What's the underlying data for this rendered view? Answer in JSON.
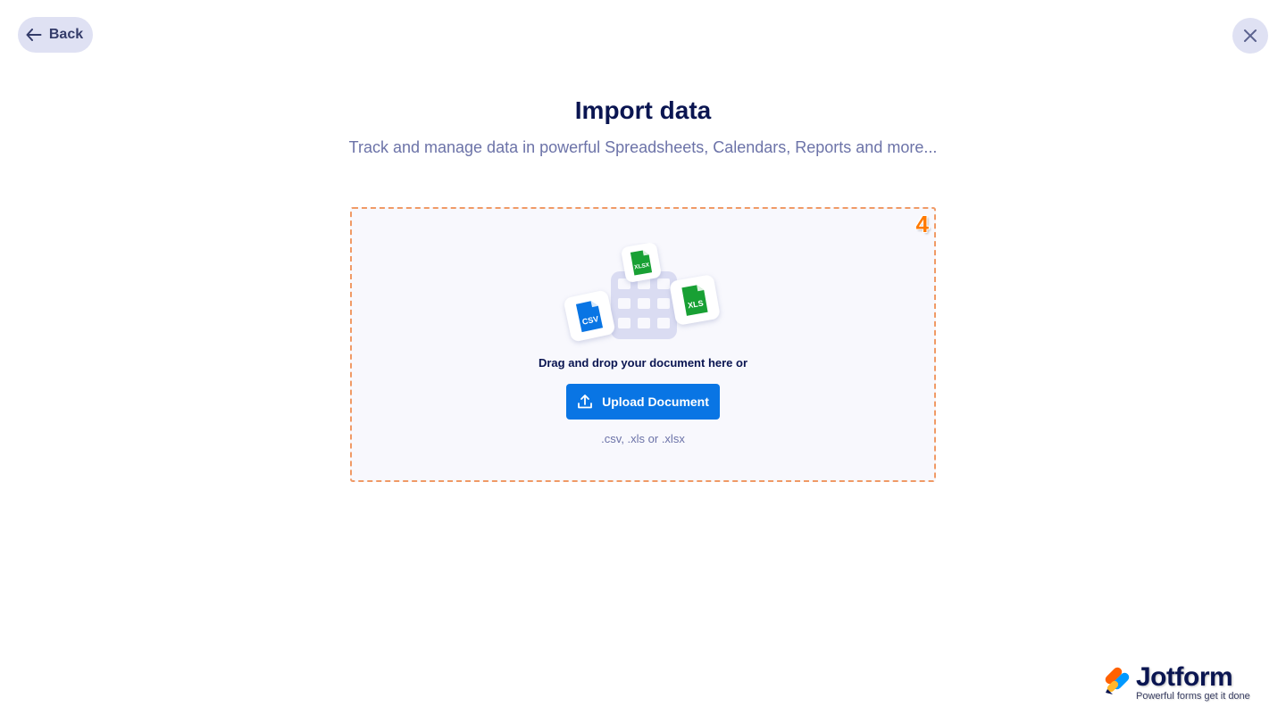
{
  "header": {
    "back_label": "Back"
  },
  "main": {
    "title": "Import data",
    "subtitle": "Track and manage data in powerful Spreadsheets, Calendars, Reports and more...",
    "dropzone": {
      "badge": "4",
      "file_icons": [
        "CSV",
        "XLSX",
        "XLS"
      ],
      "drag_text": "Drag and drop your document here or",
      "upload_label": "Upload Document",
      "formats": ".csv, .xls or .xlsx"
    }
  },
  "brand": {
    "name": "Jotform",
    "tagline": "Powerful forms get it done"
  },
  "colors": {
    "primary": "#0975e4",
    "heading": "#0a1551",
    "subtle_text": "#6c73a8",
    "dropzone_border": "#f09a66",
    "badge": "#ff7a00",
    "button_bg": "#dfe1f3",
    "file_csv": "#0975e4",
    "file_xls": "#18a034"
  },
  "icons": {
    "back": "arrow-left-icon",
    "close": "close-icon",
    "upload": "upload-icon"
  }
}
